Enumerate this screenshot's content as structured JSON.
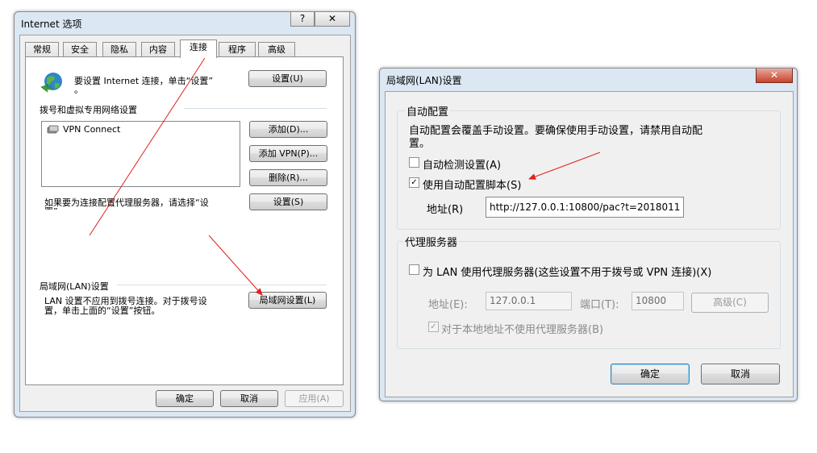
{
  "inet": {
    "title": "Internet 选项",
    "help": "?",
    "close": "✕",
    "tabs": [
      "常规",
      "安全",
      "隐私",
      "内容",
      "连接",
      "程序",
      "高级"
    ],
    "setup_text": "要设置 Internet 连接，单击“设置”",
    "setup_text2": "。",
    "setup_btn": "设置(U)",
    "dialup_heading": "拨号和虚拟专用网络设置",
    "vpn_item": "VPN Connect",
    "add_btn": "添加(D)...",
    "add_vpn_btn": "添加 VPN(P)...",
    "remove_btn": "删除(R)...",
    "proxy_text": "如果要为连接配置代理服务器，请选择“设",
    "proxy_text2": "置”。",
    "settings_btn": "设置(S)",
    "lan_heading": "局域网(LAN)设置",
    "lan_text1": "LAN 设置不应用到拨号连接。对于拨号设",
    "lan_text2": "置，单击上面的“设置”按钮。",
    "lan_btn": "局域网设置(L)",
    "ok": "确定",
    "cancel": "取消",
    "apply": "应用(A)"
  },
  "lan": {
    "title": "局域网(LAN)设置",
    "close": "✕",
    "auto_config_heading": "自动配置",
    "auto_config_desc1": "自动配置会覆盖手动设置。要确保使用手动设置，请禁用自动配",
    "auto_config_desc2": "置。",
    "auto_detect": "自动检测设置(A)",
    "use_script": "使用自动配置脚本(S)",
    "address_label": "地址(R)",
    "address_value": "http://127.0.0.1:10800/pac?t=2018011",
    "proxy_heading": "代理服务器",
    "use_proxy": "为 LAN 使用代理服务器(这些设置不用于拨号或 VPN 连接)(X)",
    "proxy_address_label": "地址(E):",
    "proxy_address_value": "127.0.0.1",
    "port_label": "端口(T):",
    "port_value": "10800",
    "advanced_btn": "高级(C)",
    "bypass_local": "对于本地地址不使用代理服务器(B)",
    "ok": "确定",
    "cancel": "取消",
    "check_mark": "✓"
  }
}
